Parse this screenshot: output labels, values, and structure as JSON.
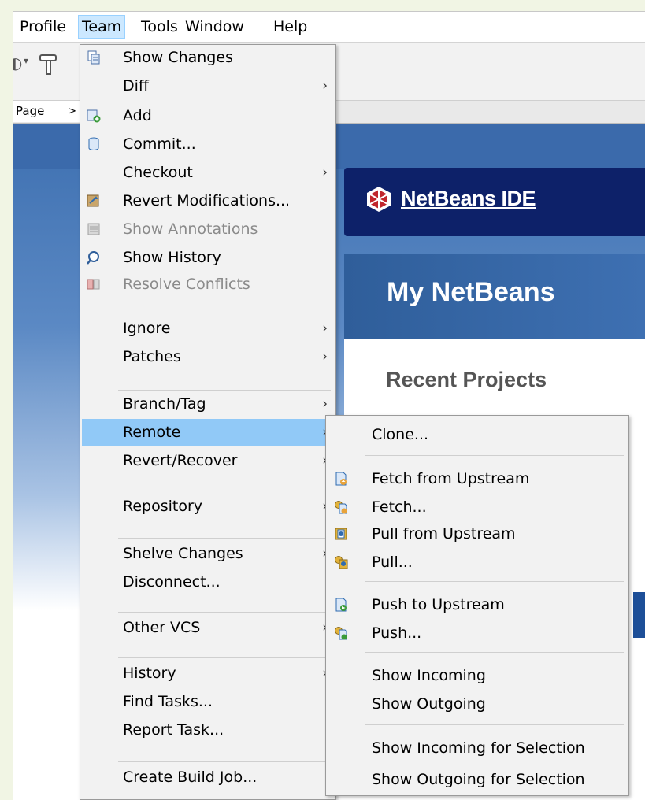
{
  "menubar": {
    "items": [
      "Profile",
      "Team",
      "Tools",
      "Window",
      "Help"
    ]
  },
  "tab": {
    "label": "Page"
  },
  "start_page": {
    "logo_text": "NetBeans IDE",
    "my_title": "My NetBeans",
    "recent_title": "Recent Projects"
  },
  "team_menu": {
    "items": [
      {
        "label": "Show Changes",
        "icon": "show-changes-icon"
      },
      {
        "label": "Diff",
        "submenu": true
      },
      {
        "label": "Add",
        "icon": "add-icon"
      },
      {
        "label": "Commit...",
        "icon": "commit-icon"
      },
      {
        "label": "Checkout",
        "submenu": true
      },
      {
        "label": "Revert Modifications...",
        "icon": "revert-icon"
      },
      {
        "label": "Show Annotations",
        "icon": "annotations-icon",
        "disabled": true
      },
      {
        "label": "Show History",
        "icon": "history-icon"
      },
      {
        "label": "Resolve Conflicts",
        "icon": "conflicts-icon",
        "disabled": true
      },
      {
        "label": "Ignore",
        "submenu": true
      },
      {
        "label": "Patches",
        "submenu": true
      },
      {
        "label": "Branch/Tag",
        "submenu": true
      },
      {
        "label": "Remote",
        "submenu": true,
        "highlighted": true
      },
      {
        "label": "Revert/Recover",
        "submenu": true
      },
      {
        "label": "Repository",
        "submenu": true
      },
      {
        "label": "Shelve Changes",
        "submenu": true
      },
      {
        "label": "Disconnect..."
      },
      {
        "label": "Other VCS",
        "submenu": true
      },
      {
        "label": "History",
        "submenu": true
      },
      {
        "label": "Find Tasks..."
      },
      {
        "label": "Report Task..."
      },
      {
        "label": "Create Build Job..."
      }
    ]
  },
  "remote_menu": {
    "items": [
      {
        "label": "Clone..."
      },
      {
        "label": "Fetch from Upstream",
        "icon": "fetch-upstream-icon"
      },
      {
        "label": "Fetch...",
        "icon": "fetch-icon"
      },
      {
        "label": "Pull from Upstream",
        "icon": "pull-upstream-icon"
      },
      {
        "label": "Pull...",
        "icon": "pull-icon"
      },
      {
        "label": "Push to Upstream",
        "icon": "push-upstream-icon"
      },
      {
        "label": "Push...",
        "icon": "push-icon"
      },
      {
        "label": "Show Incoming"
      },
      {
        "label": "Show Outgoing"
      },
      {
        "label": "Show Incoming for Selection"
      },
      {
        "label": "Show Outgoing for Selection"
      }
    ]
  }
}
